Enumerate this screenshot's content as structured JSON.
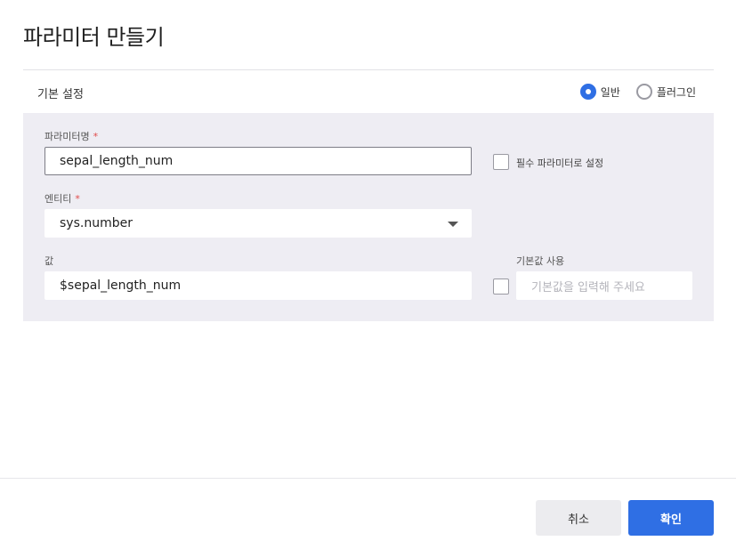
{
  "dialog": {
    "title": "파라미터 만들기"
  },
  "section": {
    "label": "기본 설정",
    "radio_options": [
      {
        "label": "일반",
        "checked": true
      },
      {
        "label": "플러그인",
        "checked": false
      }
    ]
  },
  "form": {
    "parameter_name": {
      "label": "파라미터명",
      "required_mark": "*",
      "value": "sepal_length_num"
    },
    "required_checkbox": {
      "label": "필수 파라미터로 설정",
      "checked": false
    },
    "entity": {
      "label": "엔티티",
      "required_mark": "*",
      "value": "sys.number"
    },
    "value": {
      "label": "값",
      "value": "$sepal_length_num"
    },
    "default_value": {
      "label": "기본값 사용",
      "checked": false,
      "placeholder": "기본값을 입력해 주세요"
    }
  },
  "actions": {
    "cancel_label": "취소",
    "ok_label": "확인"
  },
  "colors": {
    "accent": "#2f6fe4",
    "panel_bg": "#eeedf3",
    "required": "#e14b4b"
  }
}
